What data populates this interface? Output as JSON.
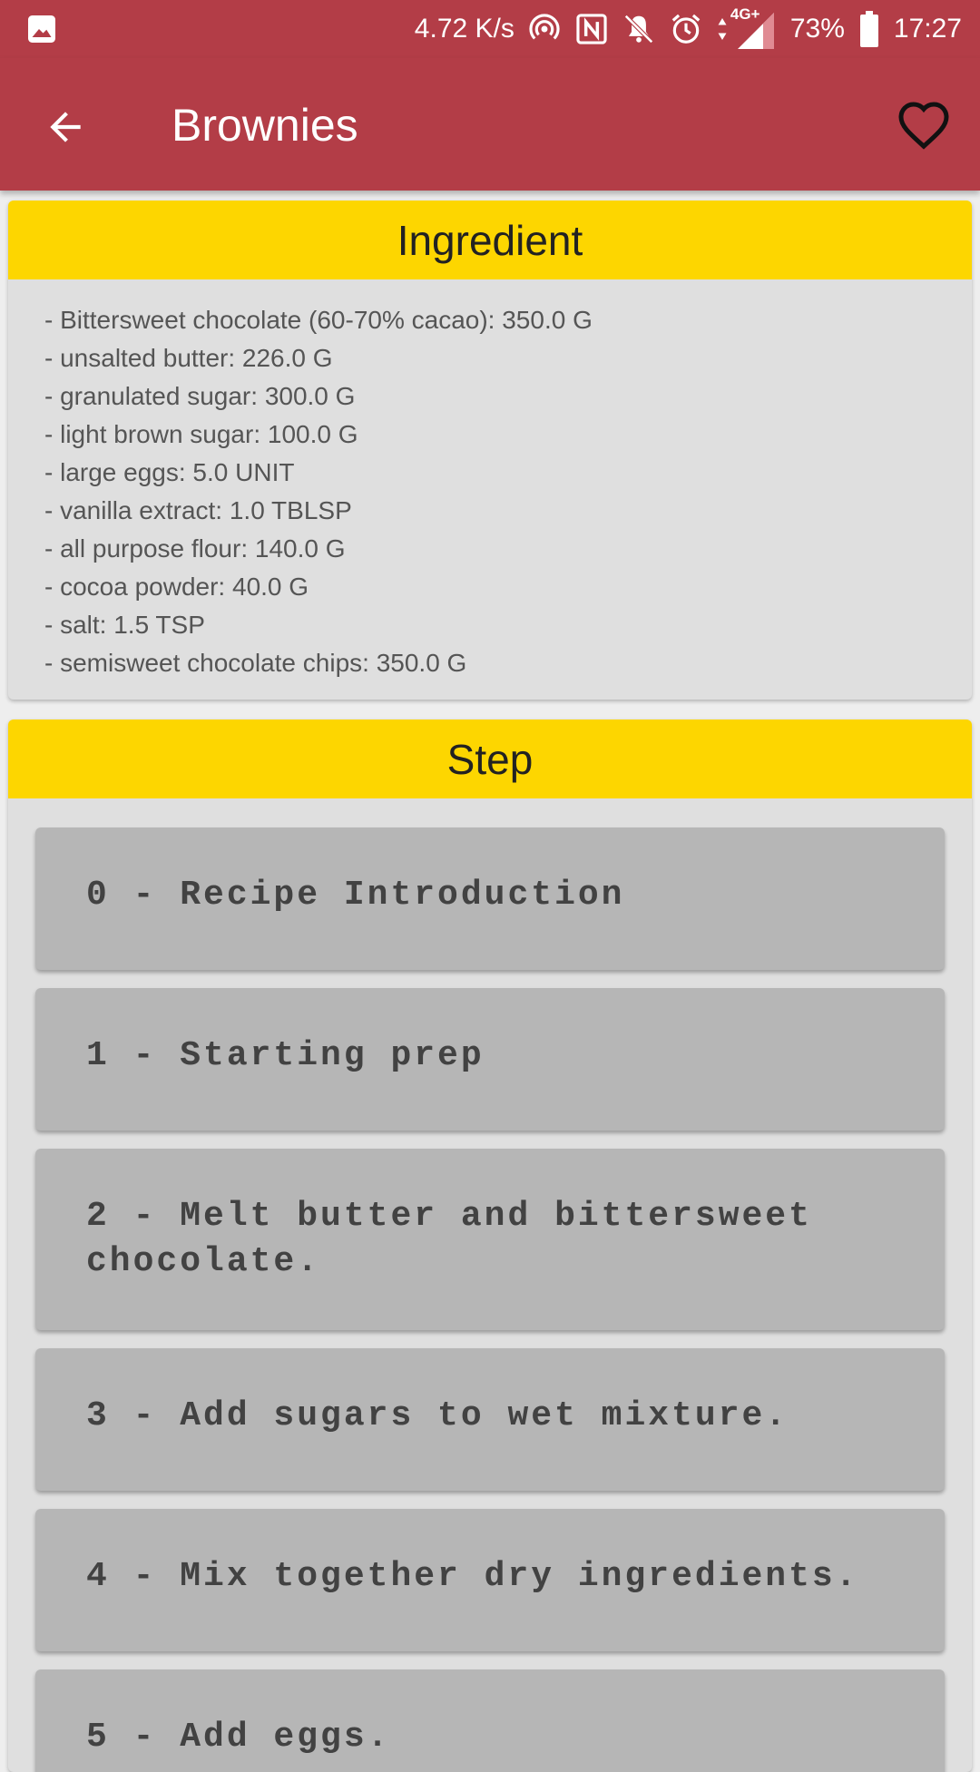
{
  "status_bar": {
    "net_speed": "4.72 K/s",
    "network_type": "4G+",
    "battery": "73%",
    "time": "17:27",
    "icons": [
      "gallery-icon",
      "hotspot-icon",
      "nfc-icon",
      "bell-off-icon",
      "alarm-icon",
      "signal-icon",
      "battery-icon"
    ]
  },
  "app_bar": {
    "title": "Brownies",
    "back_icon": "arrow-back-icon",
    "favorite_icon": "heart-outline-icon"
  },
  "ingredients": {
    "header": "Ingredient",
    "items": [
      "- Bittersweet chocolate (60-70% cacao): 350.0 G",
      "- unsalted butter: 226.0 G",
      "- granulated sugar: 300.0 G",
      "- light brown sugar: 100.0 G",
      "- large eggs: 5.0 UNIT",
      "- vanilla extract: 1.0 TBLSP",
      "- all purpose flour: 140.0 G",
      "- cocoa powder: 40.0 G",
      "- salt: 1.5 TSP",
      "- semisweet chocolate chips: 350.0 G"
    ]
  },
  "steps": {
    "header": "Step",
    "items": [
      "0 - Recipe Introduction",
      "1 - Starting prep",
      "2 - Melt butter and bittersweet chocolate.",
      "3 - Add sugars to wet mixture.",
      "4 - Mix together dry ingredients.",
      "5 - Add eggs."
    ]
  },
  "colors": {
    "app_bar": "#b33d47",
    "card_header": "#fdd600",
    "card_bg": "#dfdfdf",
    "step_bg": "#b6b6b6"
  }
}
